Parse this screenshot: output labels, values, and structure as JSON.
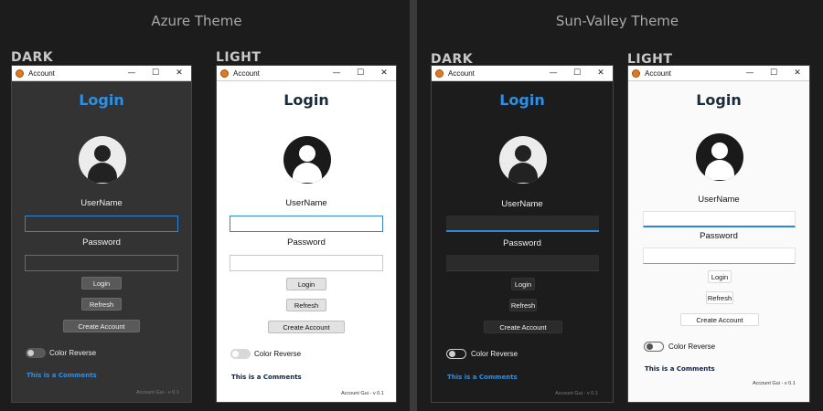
{
  "headers": {
    "azure": "Azure Theme",
    "sun_valley": "Sun-Valley Theme"
  },
  "variant_labels": {
    "dark": "DARK",
    "light": "LIGHT"
  },
  "window": {
    "title": "Account",
    "minimize_glyph": "—",
    "maximize_glyph": "☐",
    "close_glyph": "✕",
    "icon": "app-logo-icon"
  },
  "form": {
    "title": "Login",
    "avatar_icon": "user-avatar-icon",
    "username_label": "UserName",
    "username_value": "",
    "password_label": "Password",
    "password_value": "",
    "login_button": "Login",
    "refresh_button": "Refresh",
    "create_button": "Create Account",
    "switch_label": "Color Reverse",
    "switch_on": false,
    "comments": "This is a Comments",
    "version": "Account Gui - v 0.1"
  },
  "colors": {
    "accent_blue": "#2d8fe6",
    "dark_navy": "#0e2240"
  }
}
